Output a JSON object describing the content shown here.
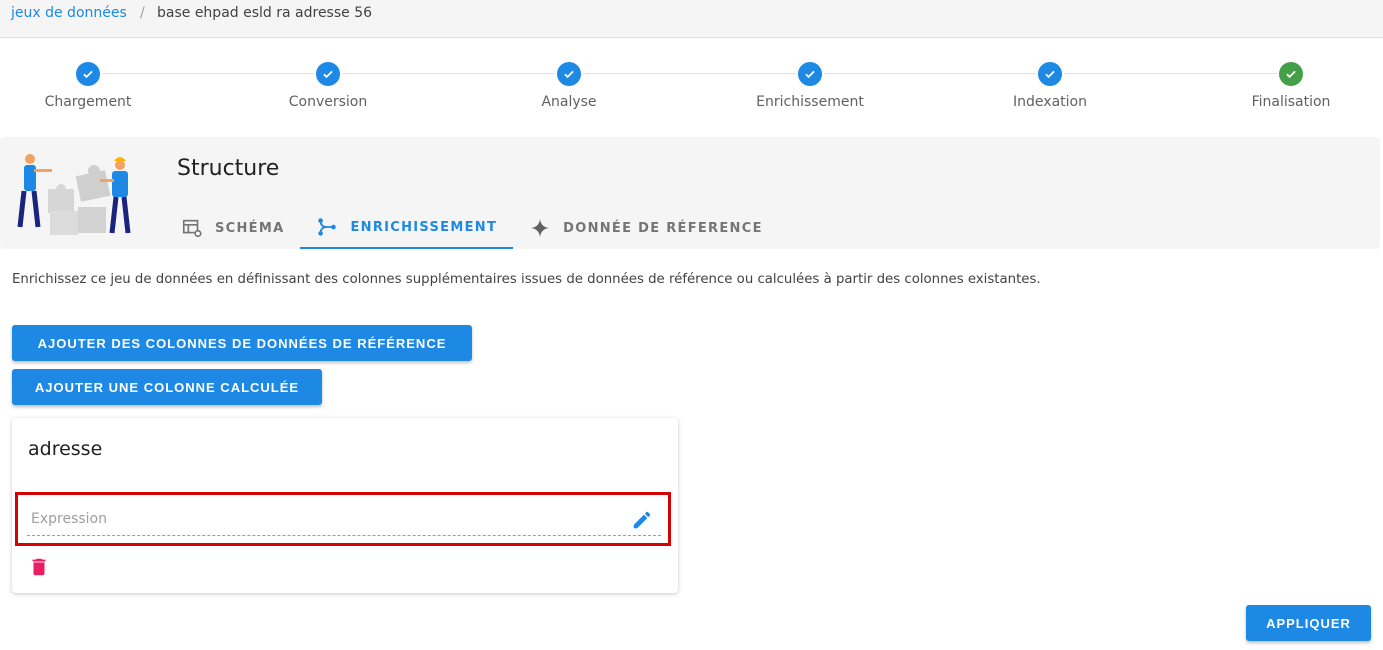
{
  "breadcrumb": {
    "parent": "jeux de données",
    "separator": "/",
    "current": "base ehpad esld ra adresse 56"
  },
  "stepper": {
    "steps": [
      {
        "label": "Chargement",
        "status": "done"
      },
      {
        "label": "Conversion",
        "status": "done"
      },
      {
        "label": "Analyse",
        "status": "done"
      },
      {
        "label": "Enrichissement",
        "status": "done"
      },
      {
        "label": "Indexation",
        "status": "done"
      },
      {
        "label": "Finalisation",
        "status": "success"
      }
    ]
  },
  "structure": {
    "title": "Structure",
    "tabs": [
      {
        "label": "SCHÉMA",
        "icon": "table-cog-icon",
        "active": false
      },
      {
        "label": "ENRICHISSEMENT",
        "icon": "merge-icon",
        "active": true
      },
      {
        "label": "DONNÉE DE RÉFERENCE",
        "icon": "sparkle-icon",
        "active": false
      }
    ]
  },
  "enrichment": {
    "description": "Enrichissez ce jeu de données en définissant des colonnes supplémentaires issues de données de référence ou calculées à partir des colonnes existantes.",
    "add_ref_button": "AJOUTER DES COLONNES DE DONNÉES DE RÉFÉRENCE",
    "add_calc_button": "AJOUTER UNE COLONNE CALCULÉE",
    "column": {
      "name": "adresse",
      "expression_placeholder": "Expression",
      "expression_value": ""
    },
    "apply_button": "APPLIQUER"
  },
  "colors": {
    "primary": "#1e88e5",
    "success": "#43a047",
    "danger": "#e91e63",
    "highlight": "#d50000"
  }
}
